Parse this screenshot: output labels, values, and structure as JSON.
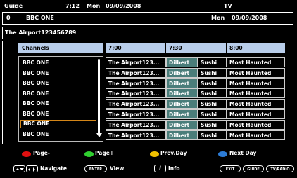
{
  "header": {
    "title": "Guide",
    "time": "7:12",
    "day": "Mon",
    "date": "09/09/2008",
    "mode": "TV"
  },
  "current_channel": {
    "number": "0",
    "name": "BBC ONE",
    "day": "Mon",
    "date": "09/09/2008"
  },
  "program_title": "The Airport123456789",
  "grid_headers": {
    "channels": "Channels",
    "slots": [
      "7:00",
      "7:30",
      "8:00"
    ]
  },
  "channels": [
    "BBC ONE",
    "BBC ONE",
    "BBC ONE",
    "BBC ONE",
    "BBC ONE",
    "BBC ONE",
    "BBC ONE",
    "BBC ONE"
  ],
  "selected_channel_index": 6,
  "grid_rows": [
    [
      "The Airport123...",
      "Dilbert",
      "Sushi",
      "Most Haunted"
    ],
    [
      "The Airport123...",
      "Dilbert",
      "Sushi",
      "Most Haunted"
    ],
    [
      "The Airport123...",
      "Dilbert",
      "Sushi",
      "Most Haunted"
    ],
    [
      "The Airport123...",
      "Dilbert",
      "Sushi",
      "Most Haunted"
    ],
    [
      "The Airport123...",
      "Dilbert",
      "Sushi",
      "Most Haunted"
    ],
    [
      "The Airport123...",
      "Dilbert",
      "Sushi",
      "Most Haunted"
    ],
    [
      "The Airport123...",
      "Dilbert",
      "Sushi",
      "Most Haunted"
    ],
    [
      "The Airport123...",
      "Dilbert",
      "Sushi",
      "Most Haunted"
    ]
  ],
  "legend": {
    "red": "Page-",
    "green": "Page+",
    "yellow": "Prev.Day",
    "blue": "Next Day"
  },
  "footer": {
    "navigate": "Navigate",
    "enter_key": "ENTER",
    "view": "View",
    "info": "Info",
    "exit_key": "EXIT",
    "guide_key": "GUIDE",
    "tvradio_key": "TV/RADIO"
  },
  "colors": {
    "header_cell_bg": "#b8cdea",
    "highlight_bg": "#4a7d7a",
    "selected_border": "#d48618",
    "red": "#e01010",
    "green": "#30d030",
    "yellow": "#f0c000",
    "blue": "#2c7cd6"
  }
}
